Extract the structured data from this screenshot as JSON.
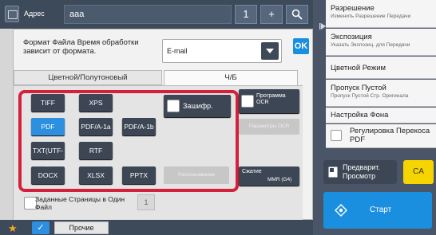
{
  "header": {
    "address_label": "Адрес",
    "address_value": "aaa",
    "count": "1",
    "plus": "+",
    "search_symbol": "⌕"
  },
  "format": {
    "label": "Формат Файла Время обработки зависит от формата.",
    "selected": "E-mail",
    "ok": "OK"
  },
  "tabs": {
    "color": "Цветной/Полутоновый",
    "bw": "Ч/Б"
  },
  "file_types": {
    "tiff": "TIFF",
    "xps": "XPS",
    "pdf": "PDF",
    "pdfa1a": "PDF/A-1a",
    "pdfa1b": "PDF/A-1b",
    "txt": "TXT(UTF-8)",
    "rtf": "RTF",
    "docx": "DOCX",
    "xlsx": "XLSX",
    "pptx": "PPTX"
  },
  "options": {
    "encrypt": "Зашифр.",
    "ocr": "Программа OCR",
    "ocr_settings": "Параметры OCR",
    "grayed": "Распознавание",
    "compression": "Сжатие",
    "compression_value": "MMR (G4)"
  },
  "multipage": {
    "label": "Заданные Страницы в Один Файл",
    "count": "1"
  },
  "bottom": {
    "prochie": "Прочие"
  },
  "sidebar": {
    "items": [
      {
        "main": "Разрешение",
        "sub": "Изменить Разрешение Передачи"
      },
      {
        "main": "Экспозиция",
        "sub": "Указать Экспозиц. для Передачи"
      },
      {
        "main": "Цветной Режим",
        "sub": ""
      },
      {
        "main": "Пропуск Пустой",
        "sub": "Пропуск Пустой Стр. Оригинала"
      },
      {
        "main": "Настройка Фона",
        "sub": ""
      },
      {
        "main": "Регулировка Перекоса PDF",
        "sub": ""
      }
    ],
    "preview": "Предварит. Просмотр",
    "ca": "CA",
    "start": "Старт"
  },
  "colors": {
    "accent": "#1a8fe0",
    "highlight": "#d4203a",
    "dark_button": "#3d4654",
    "ca": "#f5d400"
  }
}
